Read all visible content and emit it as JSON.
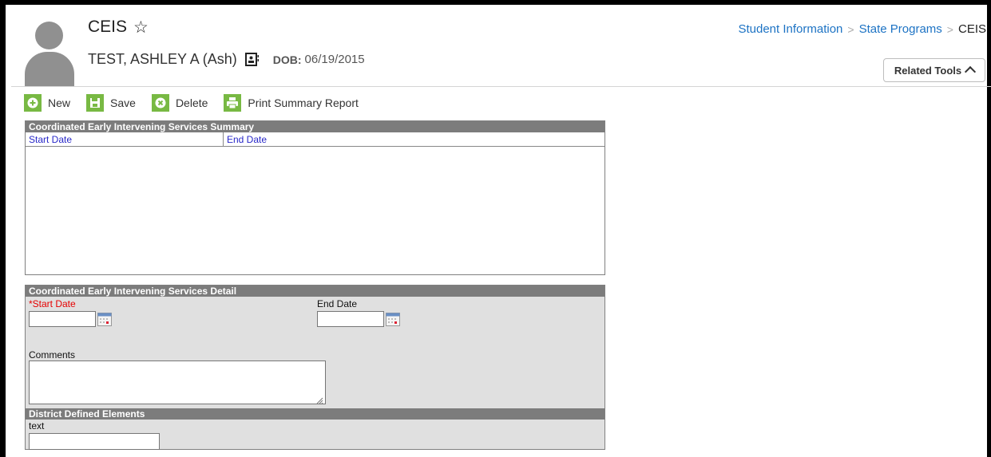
{
  "page": {
    "title": "CEIS",
    "favorite_icon": "star-outline-icon"
  },
  "student": {
    "name": "TEST, ASHLEY A (Ash)",
    "dob_label": "DOB:",
    "dob": "06/19/2015",
    "card_icon": "contact-card-icon"
  },
  "breadcrumb": {
    "items": [
      "Student Information",
      "State Programs",
      "CEIS"
    ],
    "separator": ">"
  },
  "related_tools": {
    "label": "Related Tools"
  },
  "toolbar": {
    "new_label": "New",
    "save_label": "Save",
    "delete_label": "Delete",
    "print_label": "Print Summary Report",
    "accent_color": "#78b943"
  },
  "summary": {
    "title": "Coordinated Early Intervening Services Summary",
    "columns": [
      "Start Date",
      "End Date"
    ],
    "rows": []
  },
  "detail": {
    "title": "Coordinated Early Intervening Services Detail",
    "start_date_label": "*Start Date",
    "start_date_value": "",
    "end_date_label": "End Date",
    "end_date_value": "",
    "comments_label": "Comments",
    "comments_value": ""
  },
  "district_defined": {
    "title": "District Defined Elements",
    "text_label": "text",
    "text_value": ""
  },
  "colors": {
    "link": "#1d73c4",
    "required": "#e60000",
    "column_header": "#2828c8",
    "panel_header": "#7c7c7c"
  }
}
